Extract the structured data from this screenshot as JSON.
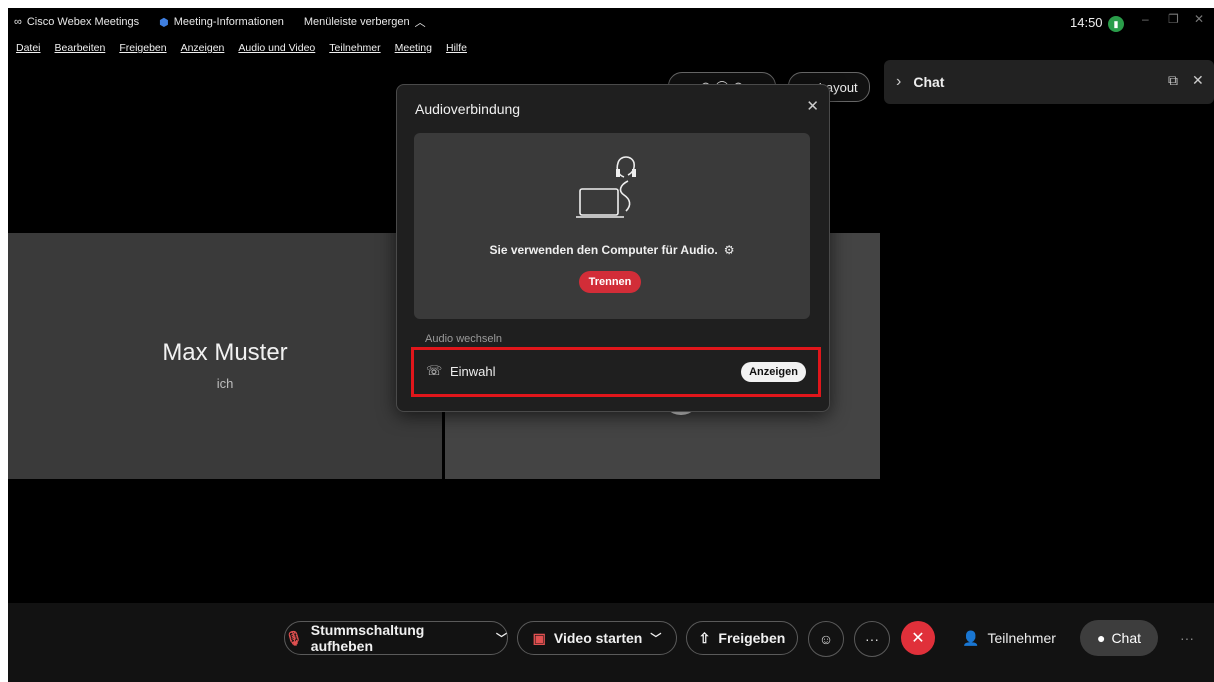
{
  "titlebar": {
    "app_name": "Cisco Webex Meetings",
    "meeting_info": "Meeting-Informationen",
    "hide_menubar": "Menüleiste verbergen",
    "clock": "14:50"
  },
  "menubar": {
    "items": [
      "Datei",
      "Bearbeiten",
      "Freigeben",
      "Anzeigen",
      "Audio und Video",
      "Teilnehmer",
      "Meeting",
      "Hilfe"
    ]
  },
  "layout_button": "Layout",
  "chat_panel": {
    "title": "Chat"
  },
  "participant": {
    "name": "Max Muster",
    "subtitle": "ich"
  },
  "dialog": {
    "title": "Audioverbindung",
    "status_text": "Sie verwenden den Computer für Audio.",
    "disconnect_label": "Trennen",
    "switch_label": "Audio wechseln",
    "dialin_label": "Einwahl",
    "show_label": "Anzeigen"
  },
  "bottombar": {
    "unmute_label": "Stummschaltung aufheben",
    "video_label": "Video starten",
    "share_label": "Freigeben",
    "participants_label": "Teilnehmer",
    "chat_label": "Chat"
  },
  "colors": {
    "end_call": "#e0303a",
    "highlight_border": "#e0161b",
    "disconnect": "#d22d38",
    "status_ok": "#2a9d4a"
  }
}
